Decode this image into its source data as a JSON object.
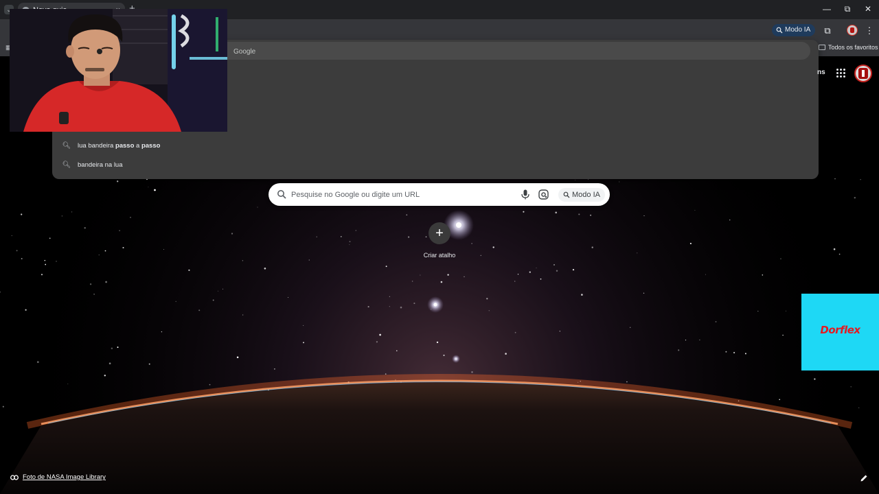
{
  "browser": {
    "tab": {
      "title": "Nova guia",
      "close": "×"
    },
    "new_tab": "+",
    "window_controls": {
      "minimize": "—",
      "restore": "⧉",
      "close": "✕"
    },
    "toolbar": {
      "modo_ia_label": "Modo IA"
    },
    "bookmarks": {
      "all_favorites": "Todos os favoritos"
    }
  },
  "omnibox": {
    "text": "Google",
    "suggestions": [
      {
        "parts": [
          {
            "text": "lua bandeira ",
            "bold": false
          },
          {
            "text": "passo",
            "bold": true
          },
          {
            "text": " a ",
            "bold": false
          },
          {
            "text": "passo",
            "bold": true
          }
        ]
      },
      {
        "parts": [
          {
            "text": "bandeira na lua",
            "bold": false
          }
        ]
      }
    ]
  },
  "ntp": {
    "account_label": "ns",
    "search": {
      "placeholder": "Pesquise no Google ou digite um URL",
      "modo_ia_label": "Modo IA"
    },
    "shortcut": {
      "label": "Criar atalho",
      "symbol": "+"
    },
    "attribution": "Foto de NASA Image Library"
  },
  "ad": {
    "brand": "Dorflex",
    "background": "#1ed8f5",
    "brand_color": "#e31b23"
  }
}
